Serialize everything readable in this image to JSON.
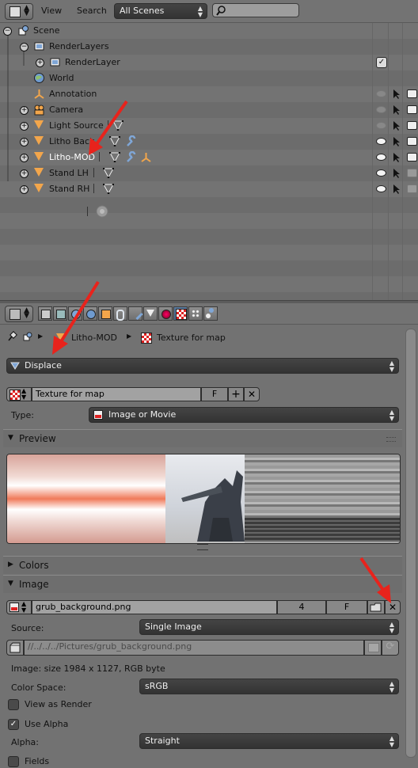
{
  "outliner": {
    "menu": [
      "View",
      "Search"
    ],
    "scene_selector": "All Scenes",
    "search_placeholder": "",
    "items": [
      {
        "label": "Scene"
      },
      {
        "label": "RenderLayers"
      },
      {
        "label": "RenderLayer",
        "checked": true
      },
      {
        "label": "World"
      },
      {
        "label": "Annotation"
      },
      {
        "label": "Camera"
      },
      {
        "label": "Light Source"
      },
      {
        "label": "Litho Back"
      },
      {
        "label": "Litho-MOD"
      },
      {
        "label": "Stand LH"
      },
      {
        "label": "Stand RH"
      }
    ]
  },
  "properties": {
    "breadcrumb": {
      "object": "Litho-MOD",
      "texture": "Texture for map"
    },
    "modifier_dropdown": "Displace",
    "texture_block": {
      "name": "Texture for map",
      "fake_user": "F"
    },
    "type_label": "Type:",
    "type_value": "Image or Movie",
    "panels": {
      "preview": "Preview",
      "colors": "Colors",
      "image": "Image"
    },
    "image_block": {
      "name": "grub_background.png",
      "users": "4",
      "fake_user": "F"
    },
    "source_label": "Source:",
    "source_value": "Single Image",
    "filepath": "//../../../Pictures/grub_background.png",
    "image_info": "Image: size 1984 x 1127, RGB byte",
    "color_space_label": "Color Space:",
    "color_space_value": "sRGB",
    "view_as_render": {
      "label": "View as Render",
      "checked": false
    },
    "use_alpha": {
      "label": "Use Alpha",
      "checked": true
    },
    "alpha_label": "Alpha:",
    "alpha_value": "Straight",
    "fields": {
      "label": "Fields",
      "checked": false
    }
  },
  "colors": {
    "arrow": "#e8231c",
    "orange": "#f3a64b",
    "selected_text": "#ffffff"
  }
}
